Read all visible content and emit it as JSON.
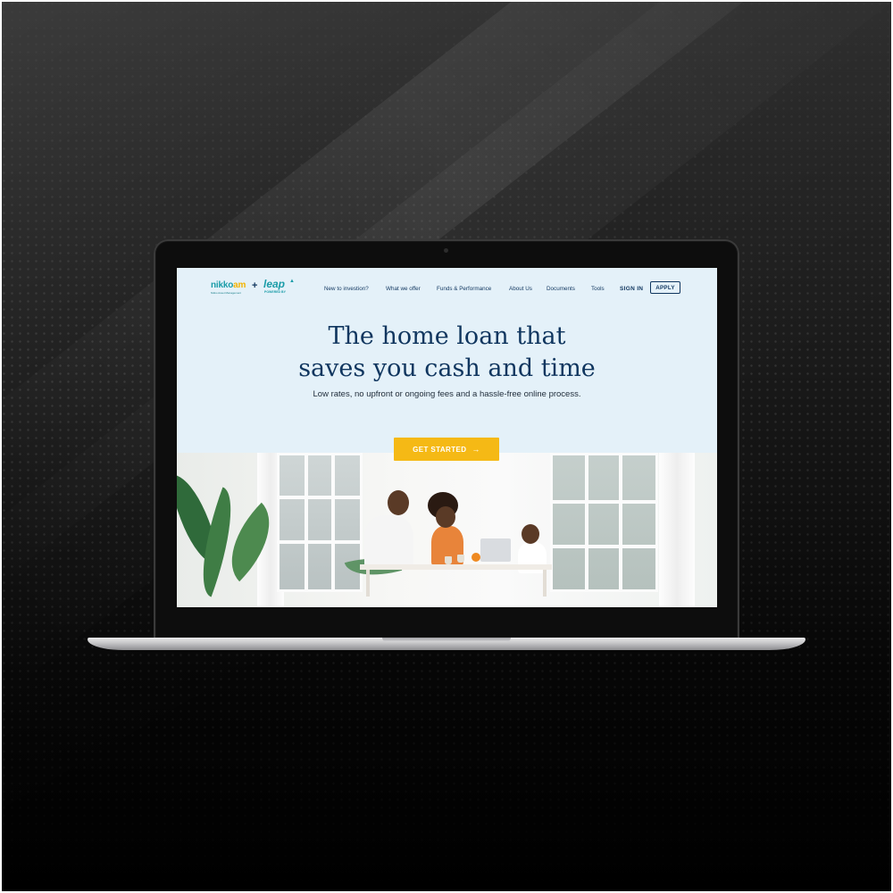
{
  "site": {
    "logo_primary_part1": "nikko",
    "logo_primary_part2": "am",
    "logo_primary_tagline": "Nikko Asset Management",
    "logo_plus": "+",
    "logo_secondary": "leap",
    "logo_secondary_tagline": "POWERED BY"
  },
  "nav": {
    "links": [
      "New to investion?",
      "What we offer",
      "Funds & Performance",
      "About Us",
      "Documents",
      "Tools"
    ],
    "sign_in": "SIGN IN",
    "apply": "APPLY"
  },
  "hero": {
    "title_line1": "The home loan that",
    "title_line2": "saves you cash and time",
    "subtitle": "Low rates, no upfront or ongoing fees and a hassle-free online process.",
    "cta_label": "GET STARTED",
    "cta_icon": "arrow-right-icon"
  },
  "colors": {
    "hero_bg": "#e4f1f9",
    "navy": "#10365f",
    "cta": "#f5b915",
    "teal": "#1a9ca8",
    "logo_accent": "#f2b300"
  }
}
